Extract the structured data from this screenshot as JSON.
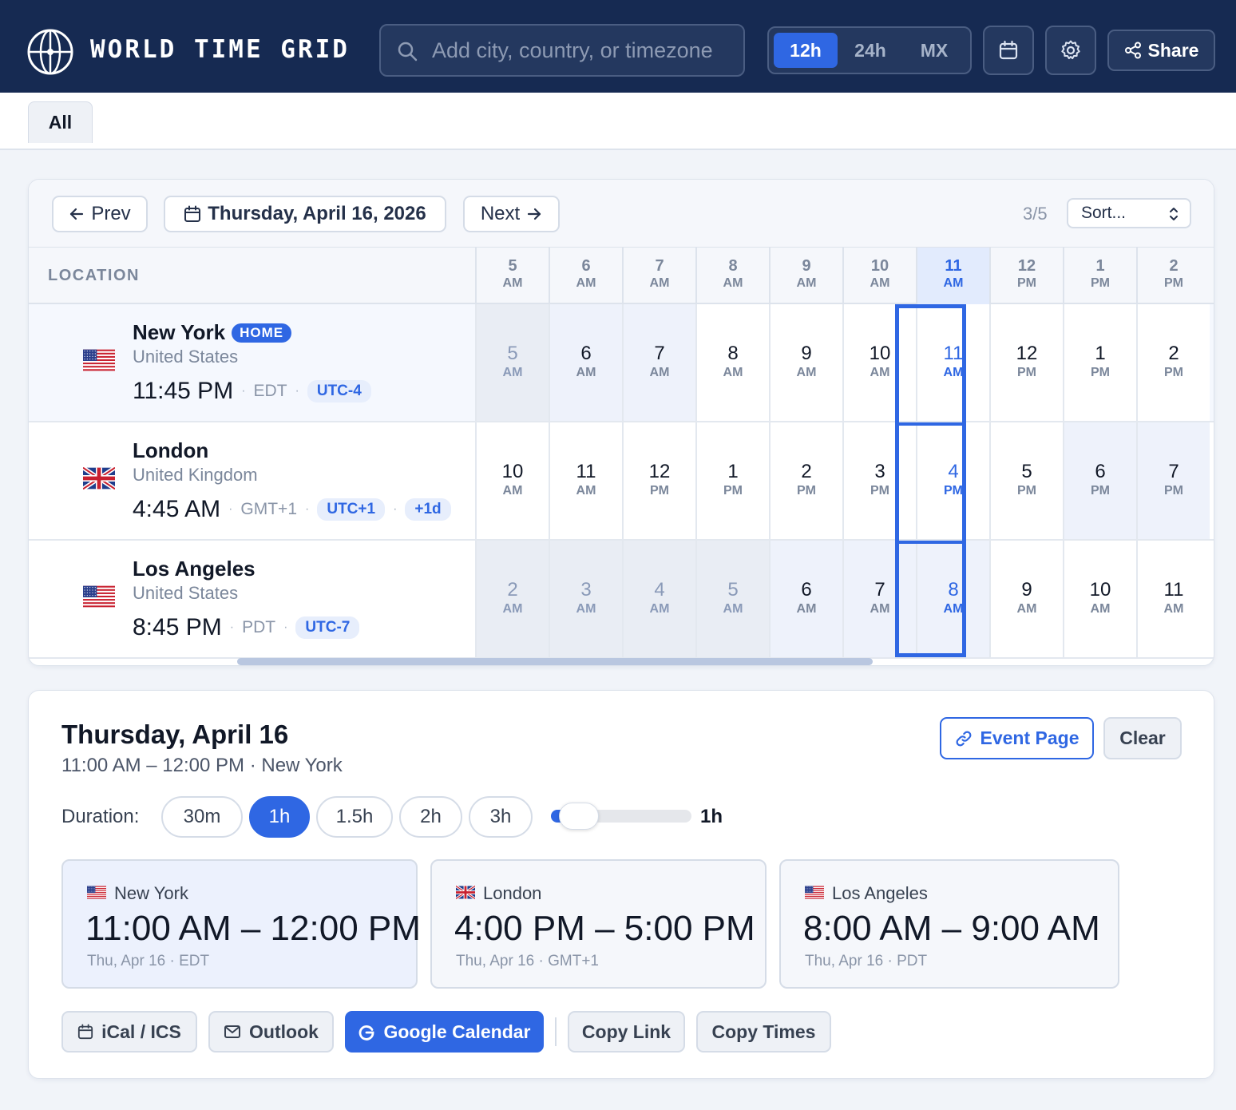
{
  "app": {
    "title": "WORLD TIME GRID"
  },
  "search": {
    "placeholder": "Add city, country, or timezone"
  },
  "formats": [
    "12h",
    "24h",
    "MX"
  ],
  "format_active": "12h",
  "header_actions": {
    "share_label": "Share",
    "calendar_icon": "calendar-icon",
    "settings_icon": "gear-icon"
  },
  "tabs": [
    {
      "label": "All"
    }
  ],
  "grid": {
    "prev_label": "Prev",
    "date_label": "Thursday, April 16, 2026",
    "next_label": "Next",
    "counter": "3/5",
    "sort_placeholder": "Sort...",
    "location_header": "LOCATION",
    "hours": [
      {
        "n": "5",
        "p": "AM"
      },
      {
        "n": "6",
        "p": "AM"
      },
      {
        "n": "7",
        "p": "AM"
      },
      {
        "n": "8",
        "p": "AM"
      },
      {
        "n": "9",
        "p": "AM"
      },
      {
        "n": "10",
        "p": "AM"
      },
      {
        "n": "11",
        "p": "AM"
      },
      {
        "n": "12",
        "p": "PM"
      },
      {
        "n": "1",
        "p": "PM"
      },
      {
        "n": "2",
        "p": "PM"
      }
    ],
    "selected_index": 6,
    "rows": [
      {
        "city": "New York",
        "badge": "HOME",
        "country": "United States",
        "flag": "us",
        "time": "11:45 PM",
        "abbr": "EDT",
        "offset": "UTC-4",
        "day_shift": "",
        "cells": [
          {
            "n": "5",
            "p": "AM",
            "k": "night"
          },
          {
            "n": "6",
            "p": "AM",
            "k": "edge"
          },
          {
            "n": "7",
            "p": "AM",
            "k": "edge"
          },
          {
            "n": "8",
            "p": "AM",
            "k": "work"
          },
          {
            "n": "9",
            "p": "AM",
            "k": "work"
          },
          {
            "n": "10",
            "p": "AM",
            "k": "work"
          },
          {
            "n": "11",
            "p": "AM",
            "k": "work"
          },
          {
            "n": "12",
            "p": "PM",
            "k": "work"
          },
          {
            "n": "1",
            "p": "PM",
            "k": "work"
          },
          {
            "n": "2",
            "p": "PM",
            "k": "work"
          }
        ]
      },
      {
        "city": "London",
        "badge": "",
        "country": "United Kingdom",
        "flag": "uk",
        "time": "4:45 AM",
        "abbr": "GMT+1",
        "offset": "UTC+1",
        "day_shift": "+1d",
        "cells": [
          {
            "n": "10",
            "p": "AM",
            "k": "work"
          },
          {
            "n": "11",
            "p": "AM",
            "k": "work"
          },
          {
            "n": "12",
            "p": "PM",
            "k": "work"
          },
          {
            "n": "1",
            "p": "PM",
            "k": "work"
          },
          {
            "n": "2",
            "p": "PM",
            "k": "work"
          },
          {
            "n": "3",
            "p": "PM",
            "k": "work"
          },
          {
            "n": "4",
            "p": "PM",
            "k": "work"
          },
          {
            "n": "5",
            "p": "PM",
            "k": "work"
          },
          {
            "n": "6",
            "p": "PM",
            "k": "edge"
          },
          {
            "n": "7",
            "p": "PM",
            "k": "edge"
          }
        ]
      },
      {
        "city": "Los Angeles",
        "badge": "",
        "country": "United States",
        "flag": "us",
        "time": "8:45 PM",
        "abbr": "PDT",
        "offset": "UTC-7",
        "day_shift": "",
        "cells": [
          {
            "n": "2",
            "p": "AM",
            "k": "night"
          },
          {
            "n": "3",
            "p": "AM",
            "k": "night"
          },
          {
            "n": "4",
            "p": "AM",
            "k": "night"
          },
          {
            "n": "5",
            "p": "AM",
            "k": "night"
          },
          {
            "n": "6",
            "p": "AM",
            "k": "edge"
          },
          {
            "n": "7",
            "p": "AM",
            "k": "edge"
          },
          {
            "n": "8",
            "p": "AM",
            "k": "edge"
          },
          {
            "n": "9",
            "p": "AM",
            "k": "work"
          },
          {
            "n": "10",
            "p": "AM",
            "k": "work"
          },
          {
            "n": "11",
            "p": "AM",
            "k": "work"
          }
        ]
      }
    ]
  },
  "detail": {
    "title": "Thursday, April 16",
    "subtitle": "11:00 AM – 12:00 PM · New York",
    "event_page_label": "Event Page",
    "clear_label": "Clear",
    "duration_label": "Duration:",
    "durations": [
      "30m",
      "1h",
      "1.5h",
      "2h",
      "3h"
    ],
    "duration_active": "1h",
    "slider_value": "1h",
    "slider_fraction": 0.08,
    "cards": [
      {
        "city": "New York",
        "flag": "us",
        "range": "11:00 AM – 12:00 PM",
        "meta": "Thu, Apr 16 · EDT",
        "home": true
      },
      {
        "city": "London",
        "flag": "uk",
        "range": "4:00 PM – 5:00 PM",
        "meta": "Thu, Apr 16 · GMT+1",
        "home": false
      },
      {
        "city": "Los Angeles",
        "flag": "us",
        "range": "8:00 AM – 9:00 AM",
        "meta": "Thu, Apr 16 · PDT",
        "home": false
      }
    ],
    "actions": [
      {
        "label": "iCal / ICS",
        "icon": "calendar-icon"
      },
      {
        "label": "Outlook",
        "icon": "mail-icon"
      },
      {
        "label": "Google Calendar",
        "icon": "google-icon"
      },
      {
        "label": "Copy Link",
        "icon": ""
      },
      {
        "label": "Copy Times",
        "icon": ""
      }
    ]
  },
  "colors": {
    "nav": "#162a52",
    "accent": "#2f67e3",
    "night": "#e9edf4",
    "edge": "#eef2fb"
  }
}
